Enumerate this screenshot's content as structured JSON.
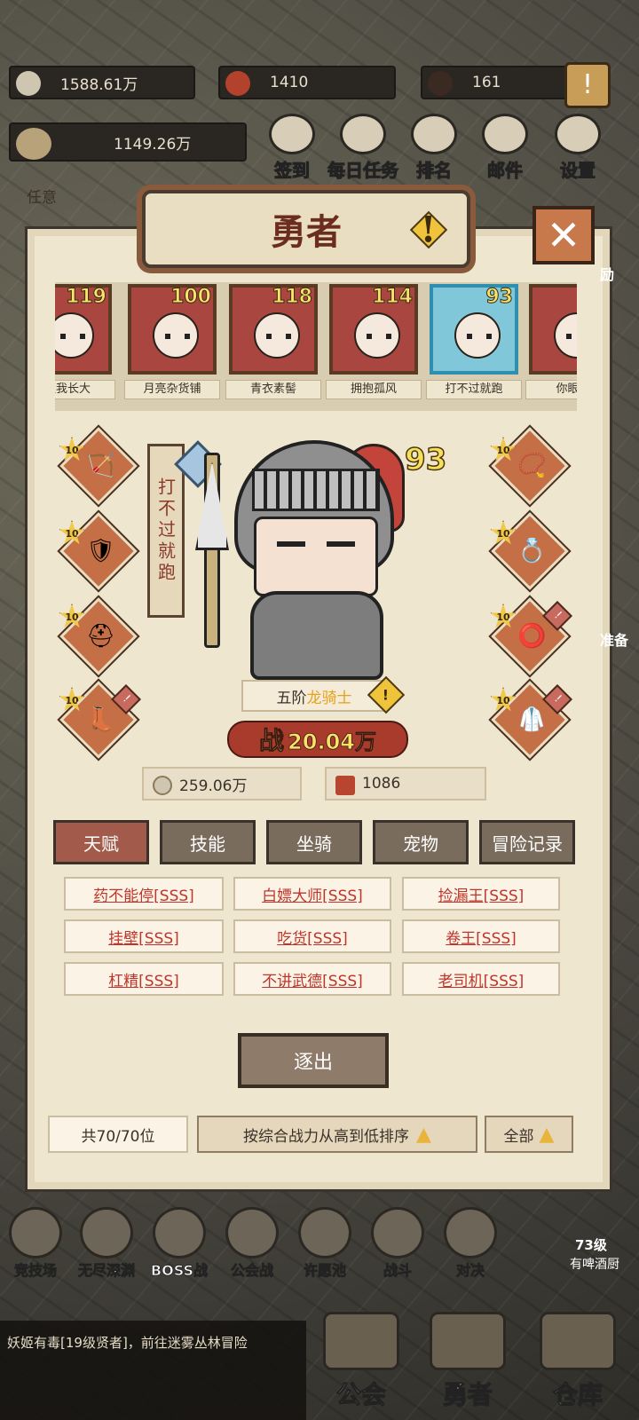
{
  "resources": {
    "gold": "1588.61万",
    "honor": "1410",
    "gem": "161",
    "power": "1149.26万"
  },
  "top_buttons": [
    "签到",
    "每日任务",
    "排名",
    "邮件",
    "设置"
  ],
  "background_snippets": {
    "left_task": "任意",
    "right_labels": [
      "励",
      "准备",
      "73级",
      "有啤酒厨"
    ]
  },
  "panel": {
    "title": "勇者",
    "heroes": [
      {
        "name": "让我长大",
        "level": "119"
      },
      {
        "name": "月亮杂货铺",
        "level": "100"
      },
      {
        "name": "青衣素髻",
        "level": "118"
      },
      {
        "name": "拥抱孤风",
        "level": "114"
      },
      {
        "name": "打不过就跑",
        "level": "93"
      },
      {
        "name": "你眼里"
      }
    ],
    "selected_hero": {
      "name": "打不过就跑",
      "level": "93",
      "rank_prefix": "五阶",
      "class": "龙骑士",
      "power_label": "战",
      "power": "20.04万"
    },
    "equipment_left": [
      {
        "level": "10",
        "icon": "crossbow-icon"
      },
      {
        "level": "10",
        "icon": "armor-icon"
      },
      {
        "level": "10",
        "icon": "helmet-icon"
      },
      {
        "level": "10",
        "icon": "boots-icon",
        "alert": "!"
      }
    ],
    "equipment_right": [
      {
        "level": "10",
        "icon": "necklace-icon"
      },
      {
        "level": "10",
        "icon": "ring-icon"
      },
      {
        "level": "10",
        "icon": "bracelet-icon",
        "alert": "!"
      },
      {
        "level": "10",
        "icon": "coat-icon",
        "alert": "!"
      }
    ],
    "stats": {
      "gold": "259.06万",
      "scroll": "1086"
    },
    "tabs": [
      "天赋",
      "技能",
      "坐骑",
      "宠物",
      "冒险记录"
    ],
    "talents": [
      "药不能停[SSS]",
      "白嫖大师[SSS]",
      "捡漏王[SSS]",
      "挂壁[SSS]",
      "吃货[SSS]",
      "卷王[SSS]",
      "杠精[SSS]",
      "不讲武德[SSS]",
      "老司机[SSS]"
    ],
    "dismiss_label": "逐出",
    "count_label": "共70/70位",
    "sort_label": "按综合战力从高到低排序",
    "filter_label": "全部"
  },
  "modes": [
    "竞技场",
    "无尽深渊",
    "BOSS战",
    "公会战",
    "许愿池",
    "战斗",
    "对决"
  ],
  "bottom_nav": [
    "公会",
    "勇者",
    "仓库"
  ],
  "chat_message": "妖姬有毒[19级贤者]，前往迷雾丛林冒险",
  "colors": {
    "accent_red": "#c0352b",
    "panel_bg": "#efe6cf",
    "tab_active": "#a25b4a"
  }
}
